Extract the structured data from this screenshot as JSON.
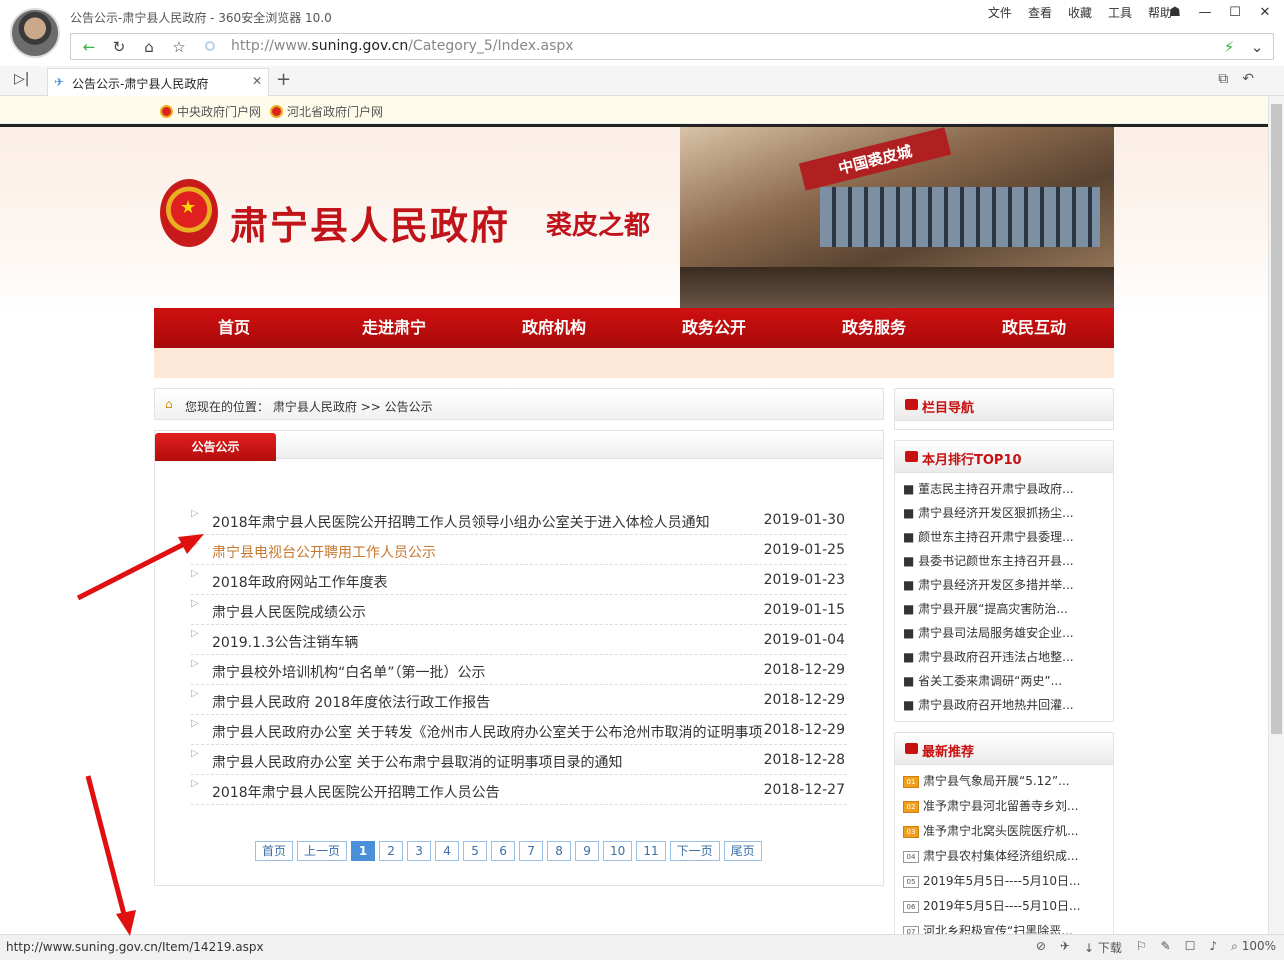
{
  "browser": {
    "window_title": "公告公示-肃宁县人民政府 - 360安全浏览器 10.0",
    "menus": [
      "文件",
      "查看",
      "收藏",
      "工具",
      "帮助"
    ],
    "url_prefix": "http://www.",
    "url_domain": "suning.gov.cn",
    "url_path": "/Category_5/Index.aspx",
    "tab_title": "公告公示-肃宁县人民政府",
    "favorites": [
      "中央政府门户网",
      "河北省政府门户网"
    ],
    "status_url": "http://www.suning.gov.cn/Item/14219.aspx",
    "download_label": "下载",
    "zoom": "100%"
  },
  "site": {
    "title": "肃宁县人民政府",
    "slogan": "裘皮之都",
    "building_sign": "中国裘皮城",
    "nav": [
      "首页",
      "走进肃宁",
      "政府机构",
      "政务公开",
      "政务服务",
      "政民互动"
    ],
    "breadcrumb_prefix": "您现在的位置：",
    "breadcrumb_home": "肃宁县人民政府",
    "breadcrumb_sep": ">>",
    "breadcrumb_current": "公告公示",
    "list_tab": "公告公示"
  },
  "notices": [
    {
      "title": "2018年肃宁县人民医院公开招聘工作人员领导小组办公室关于进入体检人员通知",
      "date": "2019-01-30"
    },
    {
      "title": "肃宁县电视台公开聘用工作人员公示",
      "date": "2019-01-25",
      "highlight": true
    },
    {
      "title": "2018年政府网站工作年度表",
      "date": "2019-01-23"
    },
    {
      "title": "肃宁县人民医院成绩公示",
      "date": "2019-01-15"
    },
    {
      "title": "2019.1.3公告注销车辆",
      "date": "2019-01-04"
    },
    {
      "title": "肃宁县校外培训机构“白名单”（第一批）公示",
      "date": "2018-12-29"
    },
    {
      "title": "肃宁县人民政府 2018年度依法行政工作报告",
      "date": "2018-12-29"
    },
    {
      "title": "肃宁县人民政府办公室 关于转发《沧州市人民政府办公室关于公布沧州市取消的证明事项",
      "date": "2018-12-29"
    },
    {
      "title": "肃宁县人民政府办公室 关于公布肃宁县取消的证明事项目录的通知",
      "date": "2018-12-28"
    },
    {
      "title": "2018年肃宁县人民医院公开招聘工作人员公告",
      "date": "2018-12-27"
    }
  ],
  "pager": [
    "首页",
    "上一页",
    "1",
    "2",
    "3",
    "4",
    "5",
    "6",
    "7",
    "8",
    "9",
    "10",
    "11",
    "下一页",
    "尾页"
  ],
  "pager_current": "1",
  "sidebar": {
    "nav_title": "栏目导航",
    "top10_title": "本月排行TOP10",
    "top10": [
      "■ 董志民主持召开肃宁县政府...",
      "■ 肃宁县经济开发区狠抓扬尘...",
      "■ 颜世东主持召开肃宁县委理...",
      "■ 县委书记颜世东主持召开县...",
      "■ 肃宁县经济开发区多措并举...",
      "■ 肃宁县开展“提高灾害防治...",
      "■ 肃宁县司法局服务雄安企业...",
      "■ 肃宁县政府召开违法占地整...",
      "■ 省关工委来肃调研“两史”...",
      "■ 肃宁县政府召开地热井回灌..."
    ],
    "new_title": "最新推荐",
    "new": [
      {
        "num": "01",
        "text": "肃宁县气象局开展“5.12”..."
      },
      {
        "num": "02",
        "text": "准予肃宁县河北留善寺乡刘..."
      },
      {
        "num": "03",
        "text": "准予肃宁北窝头医院医疗机..."
      },
      {
        "num": "04",
        "text": "肃宁县农村集体经济组织成..."
      },
      {
        "num": "05",
        "text": "2019年5月5日----5月10日..."
      },
      {
        "num": "06",
        "text": "2019年5月5日----5月10日..."
      },
      {
        "num": "07",
        "text": "河北乡积极宣传“扫黑除恶..."
      }
    ]
  },
  "colors": {
    "brand_red": "#c0141a",
    "nav_red": "#c81010",
    "link_highlight": "#c87830",
    "annotation_arrow": "#e01010"
  }
}
